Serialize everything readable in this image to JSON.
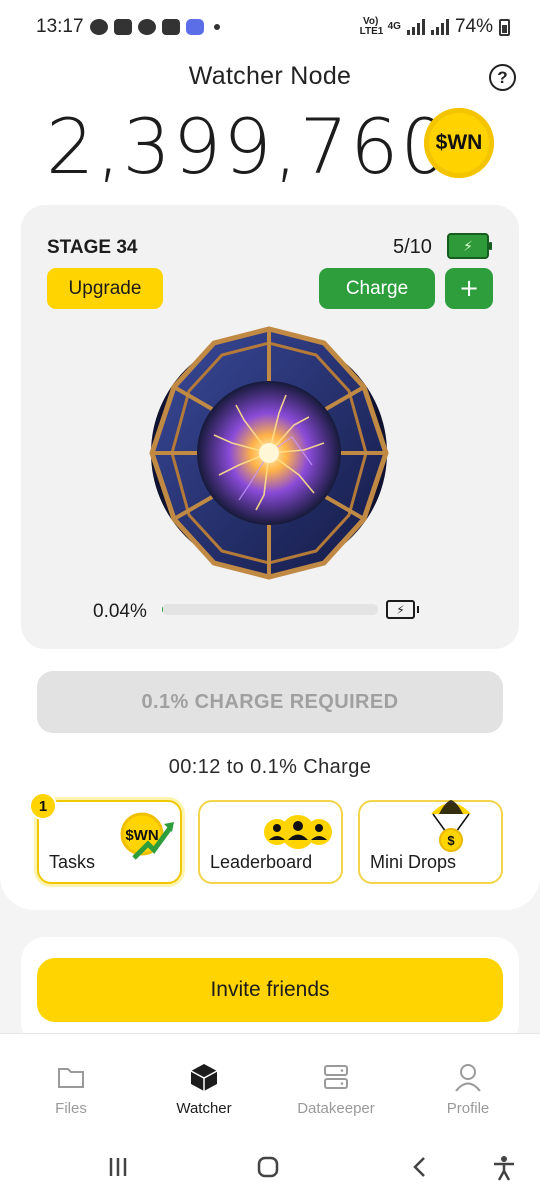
{
  "status_bar": {
    "time": "13:17",
    "network_label": "Vo) LTE1",
    "network_type": "4G",
    "battery_percent": "74%"
  },
  "header": {
    "title": "Watcher Node",
    "help_icon": "question-circle-icon"
  },
  "balance": {
    "amount": "2,399,760",
    "coin_label": "$WN"
  },
  "stage": {
    "title": "STAGE 34",
    "charges": "5/10",
    "upgrade_label": "Upgrade",
    "charge_label": "Charge",
    "plus_label": "+",
    "node_image": "energy-sphere-image",
    "progress_text": "0.04%",
    "progress_fraction": 0.0004
  },
  "charge_required": {
    "label": "0.1% CHARGE REQUIRED"
  },
  "timer": {
    "text": "00:12 to 0.1% Charge"
  },
  "tiles": [
    {
      "label": "Tasks",
      "badge": "1",
      "icon": "wn-coin-arrow-icon",
      "icon_text": "$WN"
    },
    {
      "label": "Leaderboard",
      "icon": "users-group-icon"
    },
    {
      "label": "Mini Drops",
      "icon": "parachute-coin-icon",
      "icon_text": "$"
    }
  ],
  "invite": {
    "label": "Invite friends"
  },
  "bottom_nav": [
    {
      "label": "Files",
      "icon": "folder-icon",
      "active": false
    },
    {
      "label": "Watcher",
      "icon": "cube-icon",
      "active": true
    },
    {
      "label": "Datakeeper",
      "icon": "server-icon",
      "active": false
    },
    {
      "label": "Profile",
      "icon": "person-icon",
      "active": false
    }
  ],
  "colors": {
    "accent_yellow": "#ffd400",
    "accent_green": "#2e9e3d",
    "disabled_gray": "#e2e2e2"
  }
}
